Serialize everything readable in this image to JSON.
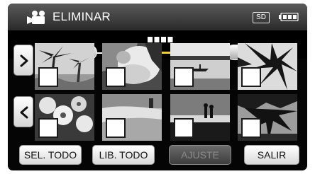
{
  "header": {
    "title": "ELIMINAR",
    "camera_icon": "video-camera-icon",
    "storage_badge": "SD",
    "battery_icon": "battery-icon"
  },
  "timeline": {
    "left_pill_icon": "previous-page-dots-icon",
    "right_pill_icon": "next-page-dots-icon",
    "position_fraction": 0.23
  },
  "nav": {
    "next_icon": "chevron-right-icon",
    "prev_icon": "chevron-left-icon"
  },
  "thumbnails": [
    {
      "scene": "palm-trees-beach",
      "checked": false
    },
    {
      "scene": "wedding-portrait",
      "checked": false
    },
    {
      "scene": "boat-on-lake",
      "checked": false
    },
    {
      "scene": "palm-leaves-silhouette",
      "checked": false
    },
    {
      "scene": "flowers",
      "checked": false
    },
    {
      "scene": "sandy-beach",
      "checked": false
    },
    {
      "scene": "couple-at-sunset",
      "checked": false
    },
    {
      "scene": "tree-silhouette",
      "checked": false
    }
  ],
  "buttons": {
    "select_all": "SEL. TODO",
    "release_all": "LIB. TODO",
    "set": "AJUSTE",
    "quit": "SALIR"
  },
  "colors": {
    "accent_yellow": "#f2d21c",
    "screen_background": "#050505"
  }
}
